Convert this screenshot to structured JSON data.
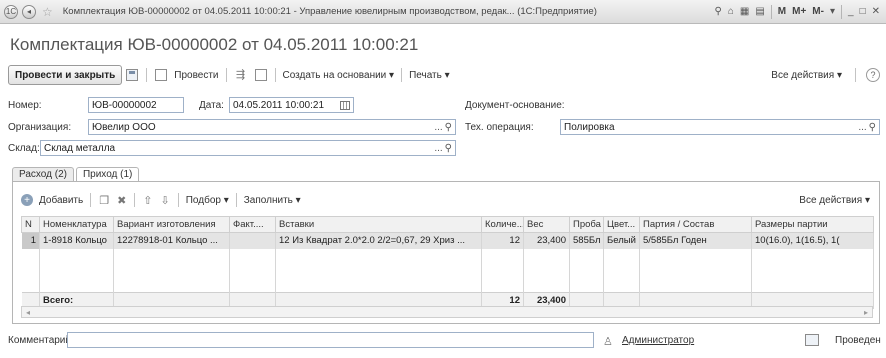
{
  "window": {
    "title": "Комплектация ЮВ-00000002 от 04.05.2011 10:00:21 - Управление ювелирным производством, редак... (1С:Предприятие)",
    "m_labels": [
      "M",
      "M+",
      "M-"
    ]
  },
  "document": {
    "heading": "Комплектация ЮВ-00000002 от 04.05.2011 10:00:21"
  },
  "toolbar": {
    "post_close": "Провести и закрыть",
    "post": "Провести",
    "create_based": "Создать на основании",
    "print": "Печать",
    "all_actions": "Все действия",
    "help": "?"
  },
  "form": {
    "number_label": "Номер:",
    "number_value": "ЮВ-00000002",
    "date_label": "Дата:",
    "date_value": "04.05.2011 10:00:21",
    "basis_label": "Документ-основание:",
    "org_label": "Организация:",
    "org_value": "Ювелир ООО",
    "techop_label": "Тех. операция:",
    "techop_value": "Полировка",
    "warehouse_label": "Склад:",
    "warehouse_value": "Склад металла",
    "comment_label": "Комментарий:",
    "comment_value": ""
  },
  "tabs": [
    {
      "label": "Расход (2)",
      "active": false
    },
    {
      "label": "Приход (1)",
      "active": true
    }
  ],
  "table_toolbar": {
    "add": "Добавить",
    "selection": "Подбор",
    "fill": "Заполнить",
    "all_actions": "Все действия"
  },
  "table": {
    "columns": [
      "N",
      "Номенклатура",
      "Вариант изготовления",
      "Факт....",
      "Вставки",
      "Количе...",
      "Вес",
      "Проба",
      "Цвет...",
      "Партия / Состав",
      "Размеры партии"
    ],
    "rows": [
      {
        "n": "1",
        "item": "1-8918 Кольцо",
        "variant": "12278918-01 Кольцо ...",
        "fact": "",
        "inserts": "12 Из Квадрат 2.0*2.0 2/2=0,67, 29 Хриз ...",
        "qty": "12",
        "weight": "23,400",
        "assay": "585Бл",
        "color": "Белый",
        "batch": "5/585Бл Годен",
        "sizes": "10(16.0), 1(16.5), 1("
      }
    ],
    "totals": {
      "label": "Всего:",
      "qty": "12",
      "weight": "23,400"
    }
  },
  "footer": {
    "author": "Администратор",
    "status": "Проведен"
  }
}
